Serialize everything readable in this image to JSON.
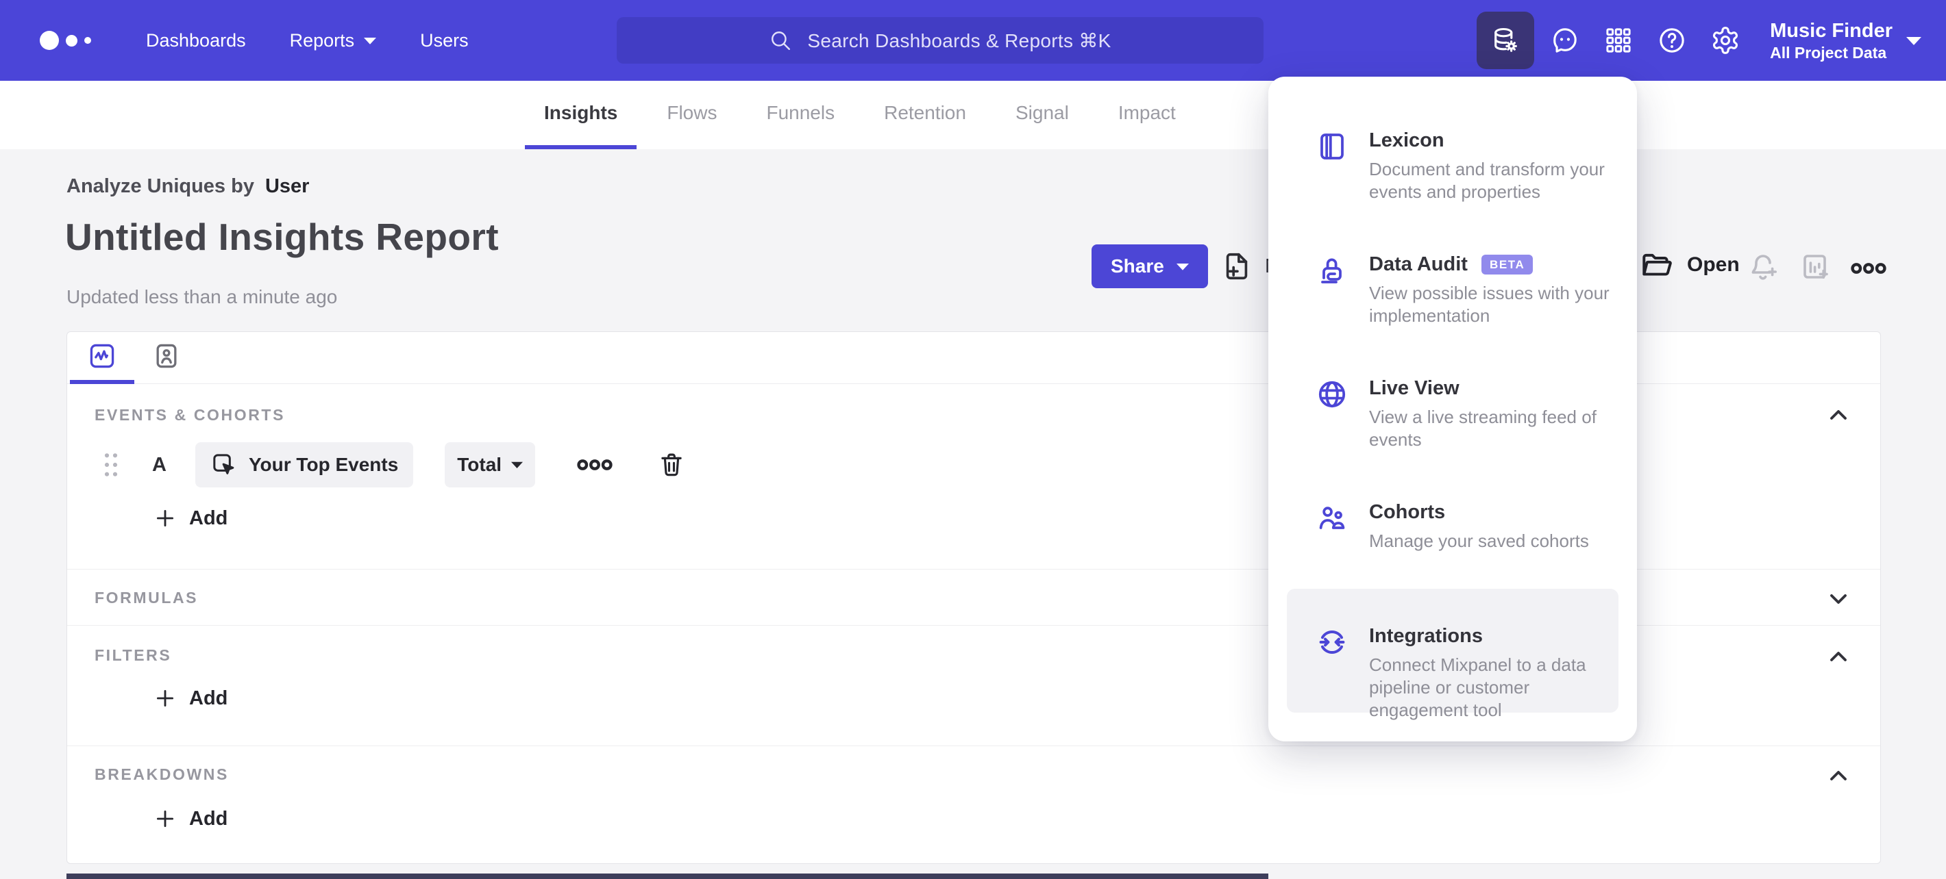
{
  "colors": {
    "accent": "#4C46D6",
    "nav_bg": "#4B45D8",
    "badge_bg": "#918AEC"
  },
  "topnav": {
    "links": [
      {
        "label": "Dashboards"
      },
      {
        "label": "Reports"
      },
      {
        "label": "Users"
      }
    ],
    "search": {
      "placeholder": "Search Dashboards & Reports ⌘K"
    },
    "icons": [
      "data-management",
      "feedback",
      "apps",
      "help",
      "settings"
    ],
    "project": {
      "name": "Music Finder",
      "scope": "All Project Data"
    }
  },
  "report_tabs": [
    {
      "label": "Insights",
      "active": true
    },
    {
      "label": "Flows"
    },
    {
      "label": "Funnels"
    },
    {
      "label": "Retention"
    },
    {
      "label": "Signal"
    },
    {
      "label": "Impact"
    }
  ],
  "header": {
    "analyze_prefix": "Analyze Uniques by",
    "analyze_entity": "User",
    "title": "Untitled Insights Report",
    "updated": "Updated less than a minute ago",
    "share": "Share",
    "new": "New",
    "open": "Open"
  },
  "builder": {
    "events": {
      "label": "EVENTS & COHORTS",
      "series_letter": "A",
      "event_name": "Your Top Events",
      "metric": "Total",
      "add": "Add"
    },
    "formulas": {
      "label": "FORMULAS"
    },
    "filters": {
      "label": "FILTERS",
      "add": "Add"
    },
    "breakdowns": {
      "label": "BREAKDOWNS",
      "add": "Add"
    }
  },
  "data_menu": {
    "items": [
      {
        "title": "Lexicon",
        "description": "Document and transform your events and properties"
      },
      {
        "title": "Data Audit",
        "badge": "BETA",
        "description": "View possible issues with your implementation"
      },
      {
        "title": "Live View",
        "description": "View a live streaming feed of events"
      },
      {
        "title": "Cohorts",
        "description": "Manage your saved cohorts"
      },
      {
        "title": "Integrations",
        "description": "Connect Mixpanel to a data pipeline or customer engagement tool",
        "highlighted": true
      }
    ]
  }
}
